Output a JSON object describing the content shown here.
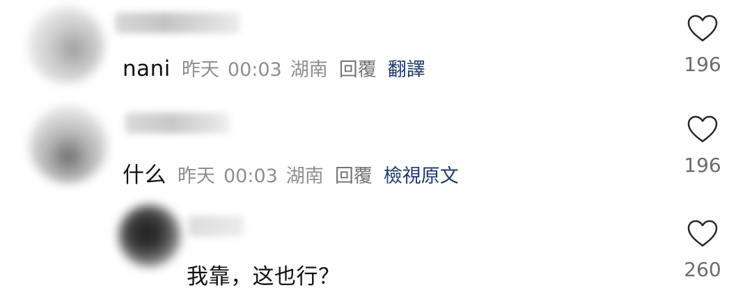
{
  "comments": [
    {
      "text": "nani",
      "date": "昨天",
      "time": "00:03",
      "location": "湖南",
      "reply_label": "回覆",
      "translate_label": "翻譯",
      "likes": "196"
    },
    {
      "text": "什么",
      "date": "昨天",
      "time": "00:03",
      "location": "湖南",
      "reply_label": "回覆",
      "translate_label": "檢視原文",
      "likes": "196"
    },
    {
      "text": "我靠，这也行？",
      "likes": "260"
    }
  ],
  "icons": {
    "like": "heart-outline-icon"
  },
  "colors": {
    "text": "#111111",
    "meta": "#8e8e8e",
    "translate_link": "#1f3a68",
    "count": "#6b6b6b"
  }
}
